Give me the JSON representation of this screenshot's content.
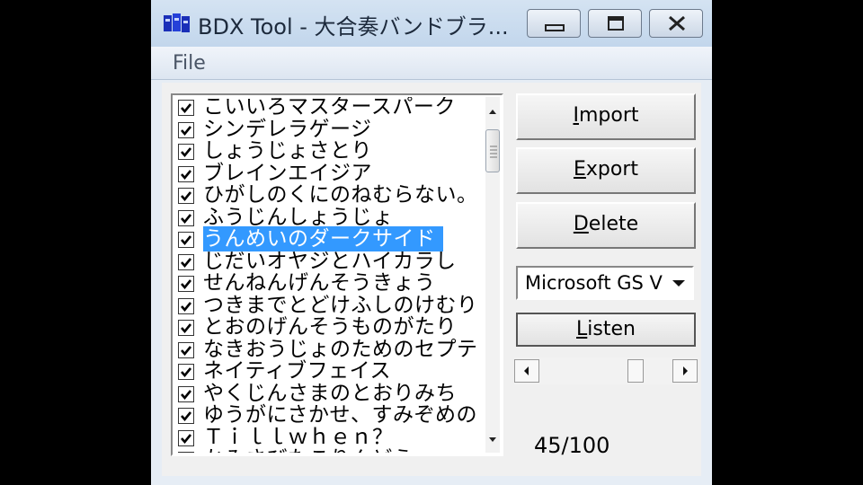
{
  "window": {
    "title": "BDX Tool - 大合奏バンドブラ...",
    "menu": {
      "file": "File"
    },
    "buttons": {
      "import": "Import",
      "import_mnemonic": "I",
      "export": "Export",
      "export_mnemonic": "E",
      "delete": "Delete",
      "delete_mnemonic": "D",
      "listen": "Listen",
      "listen_mnemonic": "L"
    },
    "voice_select": {
      "selected": "Microsoft GS V"
    },
    "voice_volume": {
      "value": 0.75
    },
    "counter": "45/100"
  },
  "song_list": {
    "selected_index": 6,
    "items": [
      {
        "label": "こいいろマスタースパーク",
        "checked": true
      },
      {
        "label": "シンデレラゲージ",
        "checked": true
      },
      {
        "label": "しょうじょさとり",
        "checked": true
      },
      {
        "label": "ブレインエイジア",
        "checked": true
      },
      {
        "label": "ひがしのくにのねむらない。",
        "checked": true
      },
      {
        "label": "ふうじんしょうじょ",
        "checked": true
      },
      {
        "label": "うんめいのダークサイド",
        "checked": true
      },
      {
        "label": "じだいオヤジとハイカラし",
        "checked": true
      },
      {
        "label": "せんねんげんそうきょう",
        "checked": true
      },
      {
        "label": "つきまでとどけふしのけむり",
        "checked": true
      },
      {
        "label": "とおのげんそうものがたり",
        "checked": true
      },
      {
        "label": "なきおうじょのためのセプテ",
        "checked": true
      },
      {
        "label": "ネイティブフェイス",
        "checked": true
      },
      {
        "label": "やくじんさまのとおりみち",
        "checked": true
      },
      {
        "label": "ゆうがにさかせ、すみぞめの",
        "checked": true
      },
      {
        "label": "Ｔｉｌｌｗｈｅｎ？",
        "checked": true
      },
      {
        "label": "かみさびたこりんどう",
        "checked": false
      }
    ]
  },
  "colors": {
    "selection": "#3399ff",
    "background": "#000000"
  }
}
